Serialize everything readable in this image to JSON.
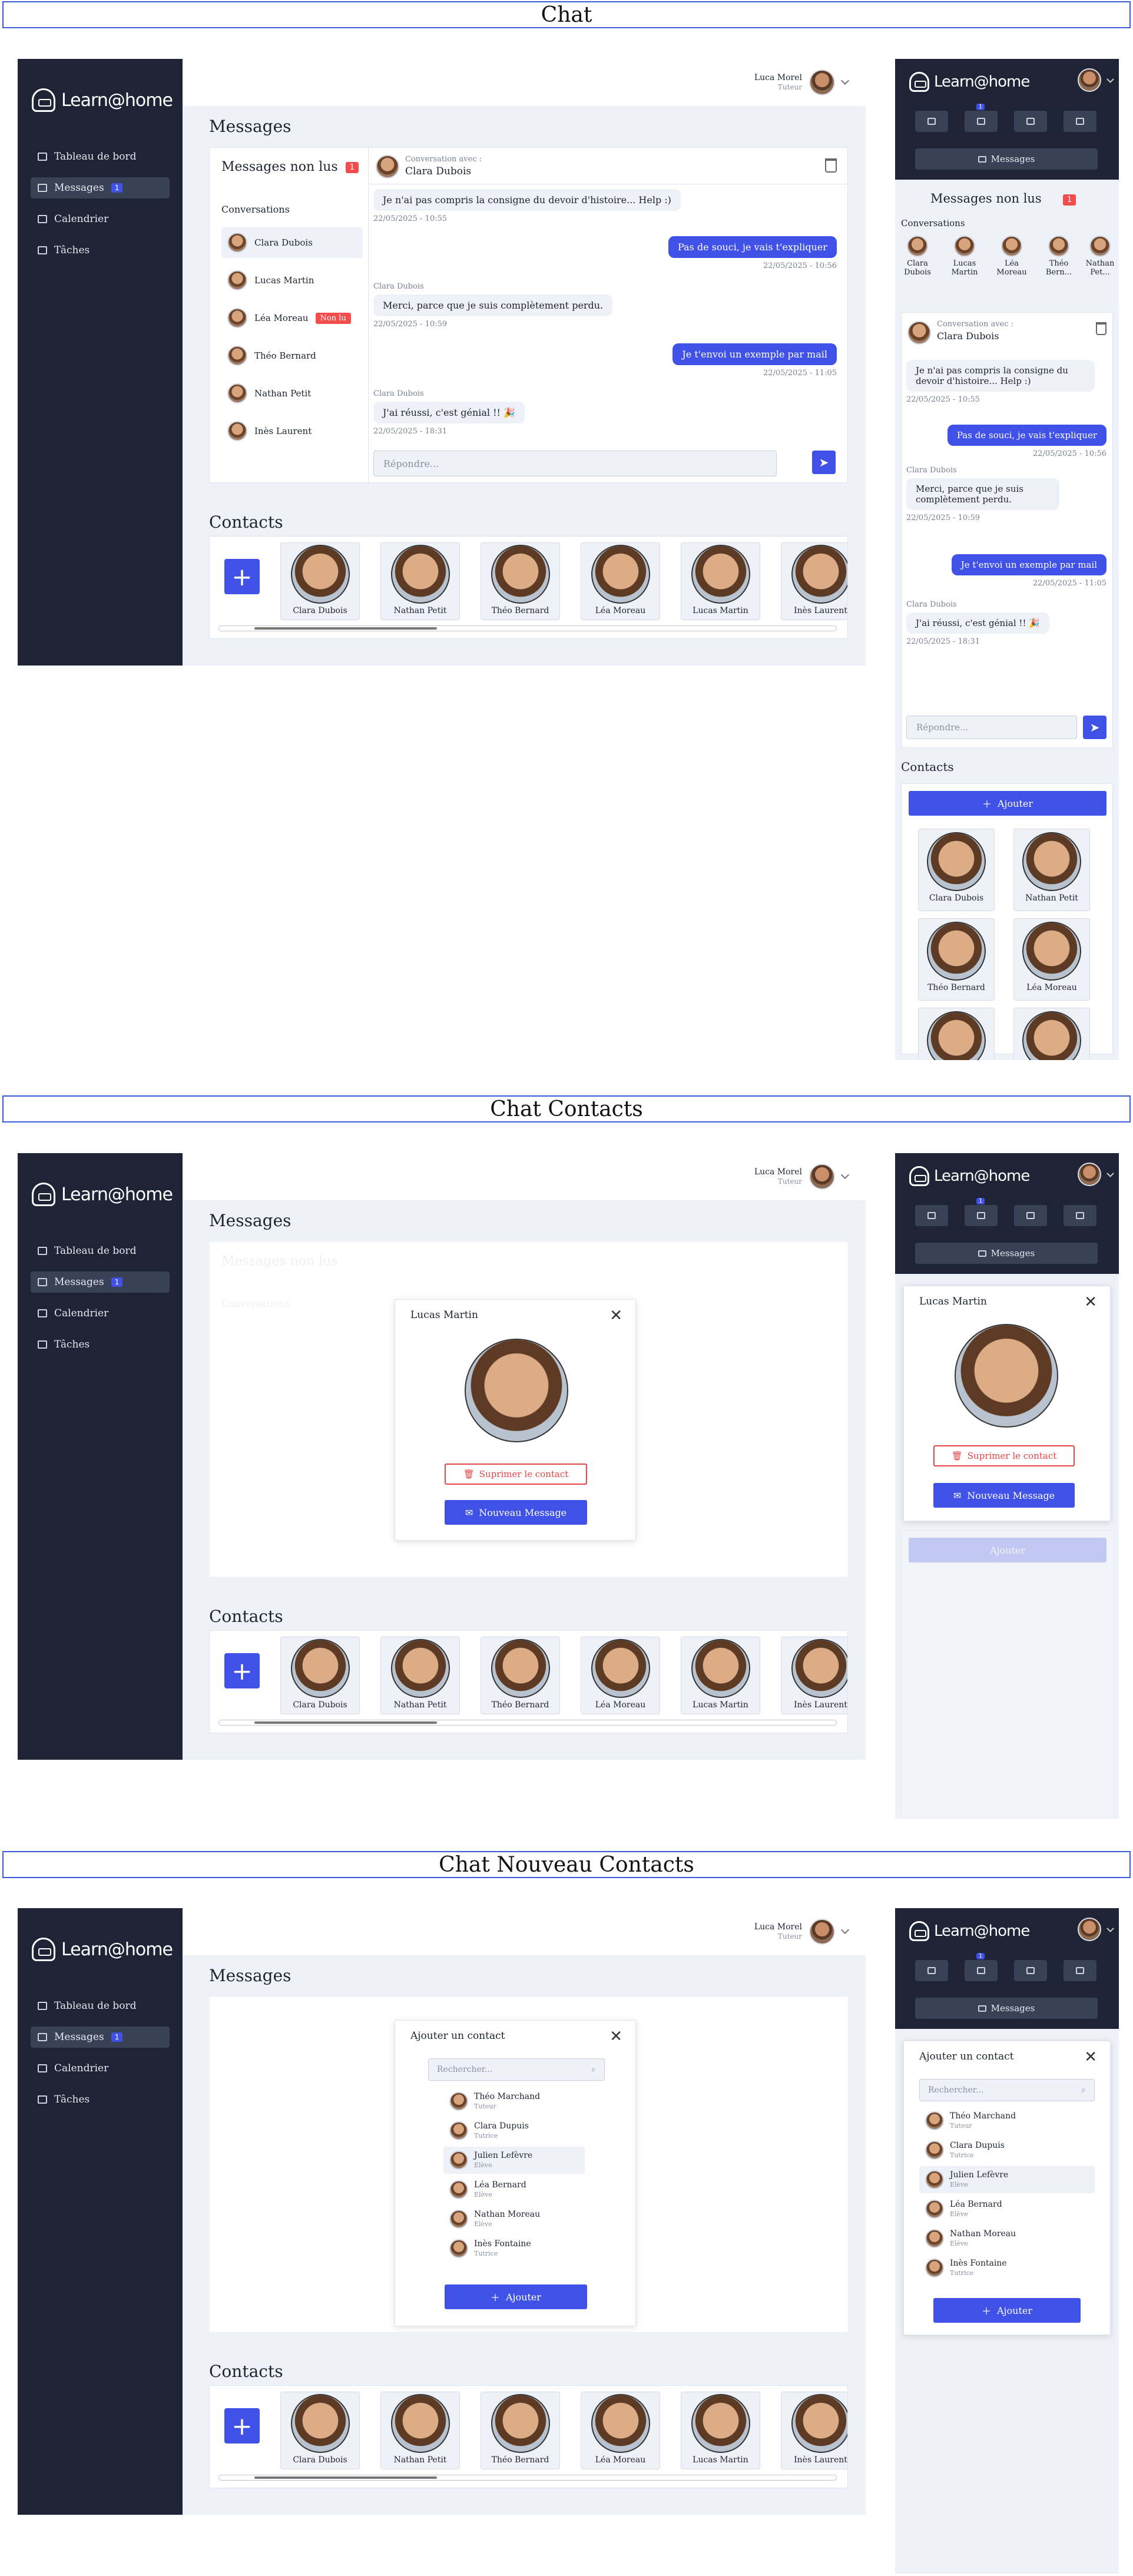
{
  "sections": [
    "Chat",
    "Chat Contacts",
    "Chat Nouveau Contacts"
  ],
  "brand": "Learn@home",
  "nav": [
    {
      "label": "Tableau de bord"
    },
    {
      "label": "Messages",
      "badge": "1"
    },
    {
      "label": "Calendrier"
    },
    {
      "label": "Tâches"
    }
  ],
  "user": {
    "name": "Luca Morel",
    "role": "Tuteur"
  },
  "messages_title": "Messages",
  "unread_title": "Messages non lus",
  "unread_count": "1",
  "conversations_label": "Conversations",
  "conversations": [
    {
      "name": "Clara Dubois"
    },
    {
      "name": "Lucas Martin"
    },
    {
      "name": "Léa Moreau",
      "tag": "Non lu"
    },
    {
      "name": "Théo Bernard"
    },
    {
      "name": "Nathan Petit"
    },
    {
      "name": "Inès Laurent"
    }
  ],
  "chat": {
    "with_label": "Conversation avec :",
    "with_name": "Clara Dubois",
    "messages": [
      {
        "text": "Je n'ai pas compris la consigne du devoir d'histoire... Help :)",
        "time": "22/05/2025 - 10:55",
        "dir": "in"
      },
      {
        "text": "Pas de souci, je vais t'expliquer",
        "time": "22/05/2025 - 10:56",
        "dir": "out"
      },
      {
        "sender": "Clara Dubois",
        "text": "Merci, parce que je suis complètement perdu.",
        "time": "22/05/2025 - 10:59",
        "dir": "in"
      },
      {
        "text": "Je t'envoi un exemple par mail",
        "time": "22/05/2025 - 11:05",
        "dir": "out"
      },
      {
        "sender": "Clara Dubois",
        "text": "J'ai réussi, c'est génial !! 🎉",
        "time": "22/05/2025 - 18:31",
        "dir": "in"
      }
    ],
    "reply_placeholder": "Répondre..."
  },
  "contacts_title": "Contacts",
  "contacts": [
    {
      "name": "Clara Dubois"
    },
    {
      "name": "Nathan Petit"
    },
    {
      "name": "Théo Bernard"
    },
    {
      "name": "Léa Moreau"
    },
    {
      "name": "Lucas Martin"
    },
    {
      "name": "Inès Laurent"
    }
  ],
  "mobile": {
    "messages_btn": "Messages",
    "add_btn": "Ajouter",
    "strip": [
      {
        "name": "Clara Dubois"
      },
      {
        "name": "Lucas Martin"
      },
      {
        "name": "Léa Moreau"
      },
      {
        "name": "Théo Bern..."
      },
      {
        "name": "Nathan Pet..."
      }
    ]
  },
  "contact_modal": {
    "name": "Lucas Martin",
    "delete": "Suprimer le contact",
    "new_message": "Nouveau Message"
  },
  "add_modal": {
    "title": "Ajouter un contact",
    "search_placeholder": "Rechercher...",
    "people": [
      {
        "name": "Théo Marchand",
        "role": "Tuteur"
      },
      {
        "name": "Clara Dupuis",
        "role": "Tutrice"
      },
      {
        "name": "Julien Lefèvre",
        "role": "Elève"
      },
      {
        "name": "Léa Bernard",
        "role": "Elève"
      },
      {
        "name": "Nathan Moreau",
        "role": "Elève"
      },
      {
        "name": "Inès Fontaine",
        "role": "Tutrice"
      }
    ],
    "add": "Ajouter"
  },
  "colors": {
    "accent": "#3f51e6",
    "sidebar": "#1e2435",
    "danger": "#f24c4c"
  }
}
